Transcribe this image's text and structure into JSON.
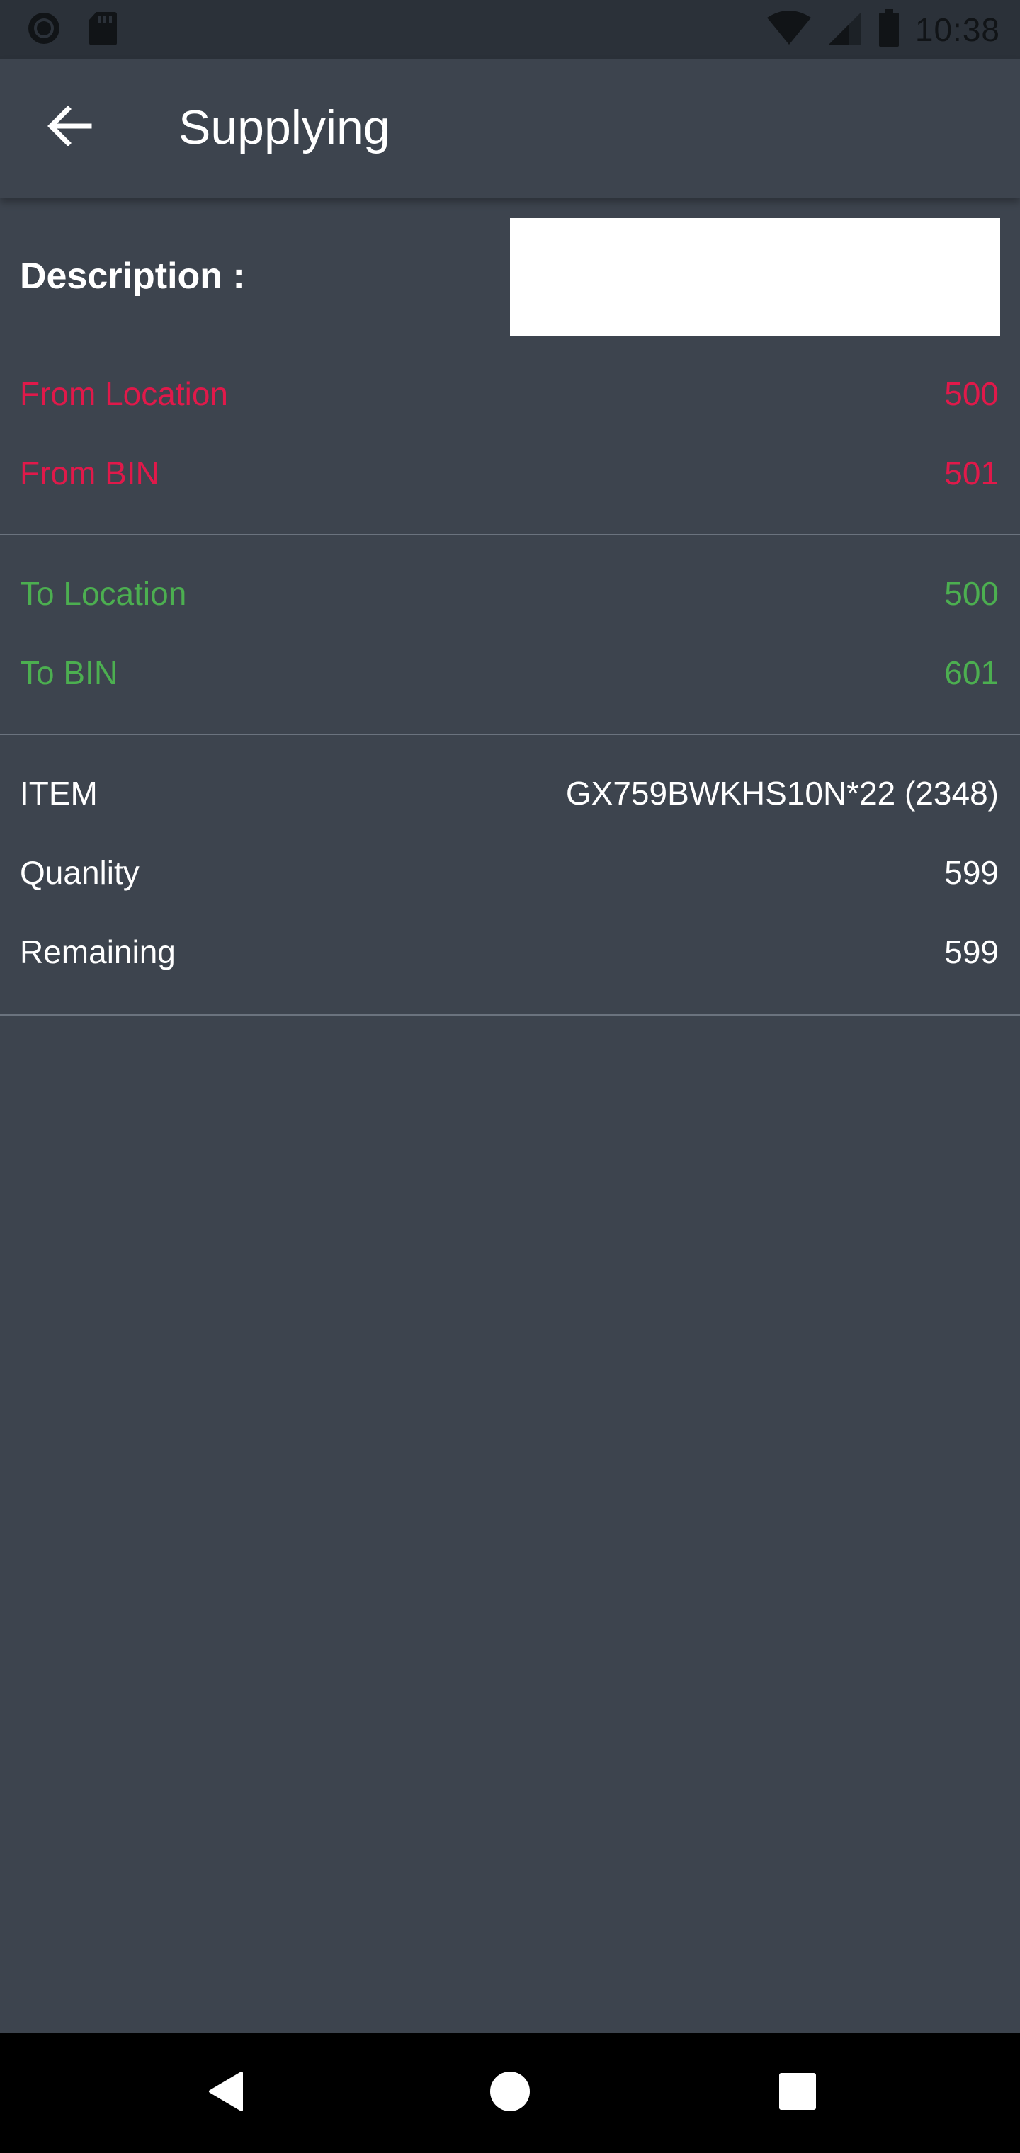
{
  "status_bar": {
    "time": "10:38",
    "icons": [
      "circle-icon",
      "sd-card-icon",
      "wifi-icon",
      "signal-icon",
      "battery-icon"
    ]
  },
  "app_bar": {
    "title": "Supplying",
    "back_icon": "arrow-left-icon"
  },
  "description": {
    "label": "Description :",
    "value": ""
  },
  "from": {
    "location_label": "From Location",
    "location_value": "500",
    "bin_label": "From BIN",
    "bin_value": "501",
    "color": "#e0194a"
  },
  "to": {
    "location_label": "To Location",
    "location_value": "500",
    "bin_label": "To BIN",
    "bin_value": "601",
    "color": "#4caf50"
  },
  "item": {
    "item_label": "ITEM",
    "item_value": "GX759BWKHS10N*22 (2348)",
    "quantity_label": "Quanlity",
    "quantity_value": "599",
    "remaining_label": "Remaining",
    "remaining_value": "599"
  },
  "nav_bar": {
    "icons": [
      "back-triangle-icon",
      "home-circle-icon",
      "recents-square-icon"
    ]
  }
}
